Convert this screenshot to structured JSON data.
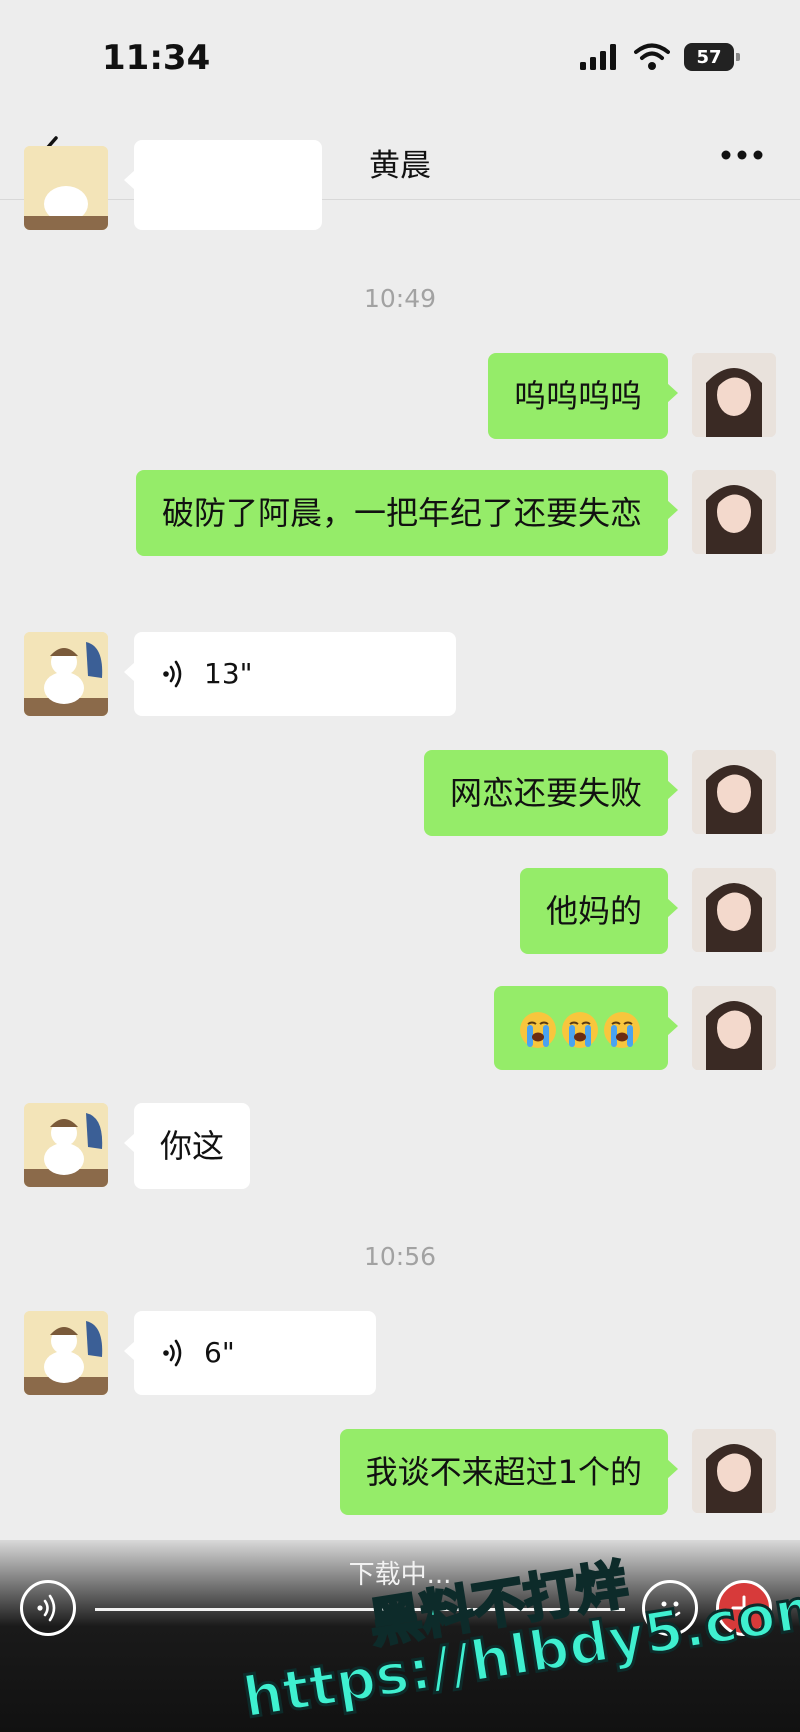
{
  "status_bar": {
    "time": "11:34",
    "battery": "57"
  },
  "nav": {
    "title": "黄晨"
  },
  "time_dividers": [
    "10:49",
    "10:56"
  ],
  "messages": [
    {
      "side": "out",
      "text": "呜呜呜呜"
    },
    {
      "side": "out",
      "text": "破防了阿晨，一把年纪了还要失恋"
    },
    {
      "side": "in",
      "type": "voice",
      "duration": "13\""
    },
    {
      "side": "out",
      "text": "网恋还要失败"
    },
    {
      "side": "out",
      "text": "他妈的"
    },
    {
      "side": "out",
      "type": "emoji",
      "emoji": [
        "loudly-crying-face",
        "loudly-crying-face",
        "loudly-crying-face"
      ]
    },
    {
      "side": "in",
      "text": "你这"
    },
    {
      "side": "in",
      "type": "voice",
      "duration": "6\""
    },
    {
      "side": "out",
      "text": "我谈不来超过1个的"
    }
  ],
  "input_bar": {
    "overlay_text": "下载中..."
  },
  "watermark": {
    "line1": "黑料不打烊",
    "line2": "https://hlbdy5.com"
  },
  "colors": {
    "background": "#ededed",
    "outgoing_bubble": "#95ec69",
    "incoming_bubble": "#ffffff"
  }
}
